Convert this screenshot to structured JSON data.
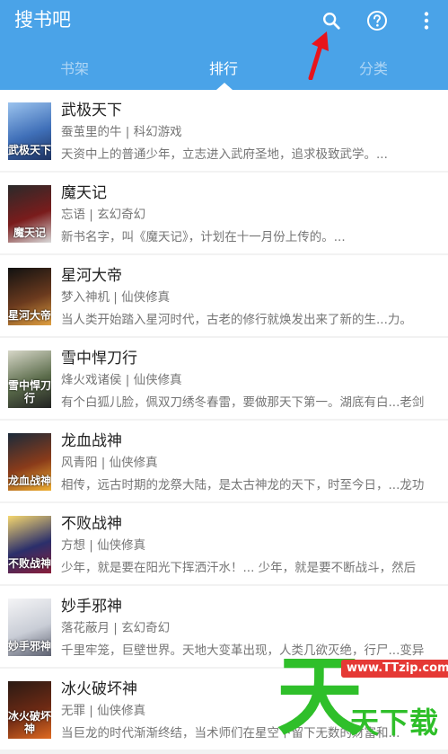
{
  "app": {
    "title": "搜书吧",
    "accent": "#4aa3e8"
  },
  "toolbar": {
    "search_icon": "search-icon",
    "help_icon": "help-circle-icon",
    "more_icon": "more-vertical-icon",
    "annotation_icon": "red-arrow-icon"
  },
  "tabs": [
    {
      "label": "书架",
      "active": false
    },
    {
      "label": "排行",
      "active": true
    },
    {
      "label": "分类",
      "active": false
    }
  ],
  "books": [
    {
      "title": "武极天下",
      "author": "蚕茧里的牛",
      "genre": "科幻游戏",
      "meta": "蚕茧里的牛 | 科幻游戏",
      "desc": "天资中上的普通少年，立志进入武府圣地，追求极致武学。...",
      "cover_color": "#3f6fb8",
      "cover_text": "武极天下"
    },
    {
      "title": "魔天记",
      "author": "忘语",
      "genre": "玄幻奇幻",
      "meta": "忘语 | 玄幻奇幻",
      "desc": "新书名字，叫《魔天记》，计划在十一月份上传的。...",
      "cover_color": "#7a1c1c",
      "cover_text": "魔天记"
    },
    {
      "title": "星河大帝",
      "author": "梦入神机",
      "genre": "仙侠修真",
      "meta": "梦入神机 | 仙侠修真",
      "desc": "当人类开始踏入星河时代，古老的修行就焕发出来了新的生...力。",
      "cover_color": "#6b3a1e",
      "cover_text": "星河大帝"
    },
    {
      "title": "雪中悍刀行",
      "author": "烽火戏诸侯",
      "genre": "仙侠修真",
      "meta": "烽火戏诸侯 | 仙侠修真",
      "desc": "有个白狐儿脸，佩双刀绣冬春雷，要做那天下第一。湖底有白...老剑",
      "cover_color": "#5a6b4a",
      "cover_text": "雪中悍刀行"
    },
    {
      "title": "龙血战神",
      "author": "风青阳",
      "genre": "仙侠修真",
      "meta": "风青阳 | 仙侠修真",
      "desc": "相传，远古时期的龙祭大陆，是太古神龙的天下，时至今日，...龙功",
      "cover_color": "#8a3b1a",
      "cover_text": "龙血战神"
    },
    {
      "title": "不败战神",
      "author": "方想",
      "genre": "仙侠修真",
      "meta": "方想 | 仙侠修真",
      "desc": "少年，就是要在阳光下挥洒汗水！...    少年，就是要不断战斗，然后",
      "cover_color": "#2b2f6b",
      "cover_text": "不败战神"
    },
    {
      "title": "妙手邪神",
      "author": "落花蔽月",
      "genre": "玄幻奇幻",
      "meta": "落花蔽月 | 玄幻奇幻",
      "desc": "千里牢笼，巨壁世界。天地大变革出现，人类几欲灭绝，行尸...变异",
      "cover_color": "#c9cdd6",
      "cover_text": "妙手邪神"
    },
    {
      "title": "冰火破坏神",
      "author": "无罪",
      "genre": "仙侠修真",
      "meta": "无罪 | 仙侠修真",
      "desc": "当巨龙的时代渐渐终结，当术师们在星空下留下无数的财富和...",
      "cover_color": "#6e2a14",
      "cover_text": "冰火破坏神"
    }
  ],
  "watermark": {
    "glyph": "天",
    "url": "www.TTzip.com",
    "text": "天下载"
  }
}
